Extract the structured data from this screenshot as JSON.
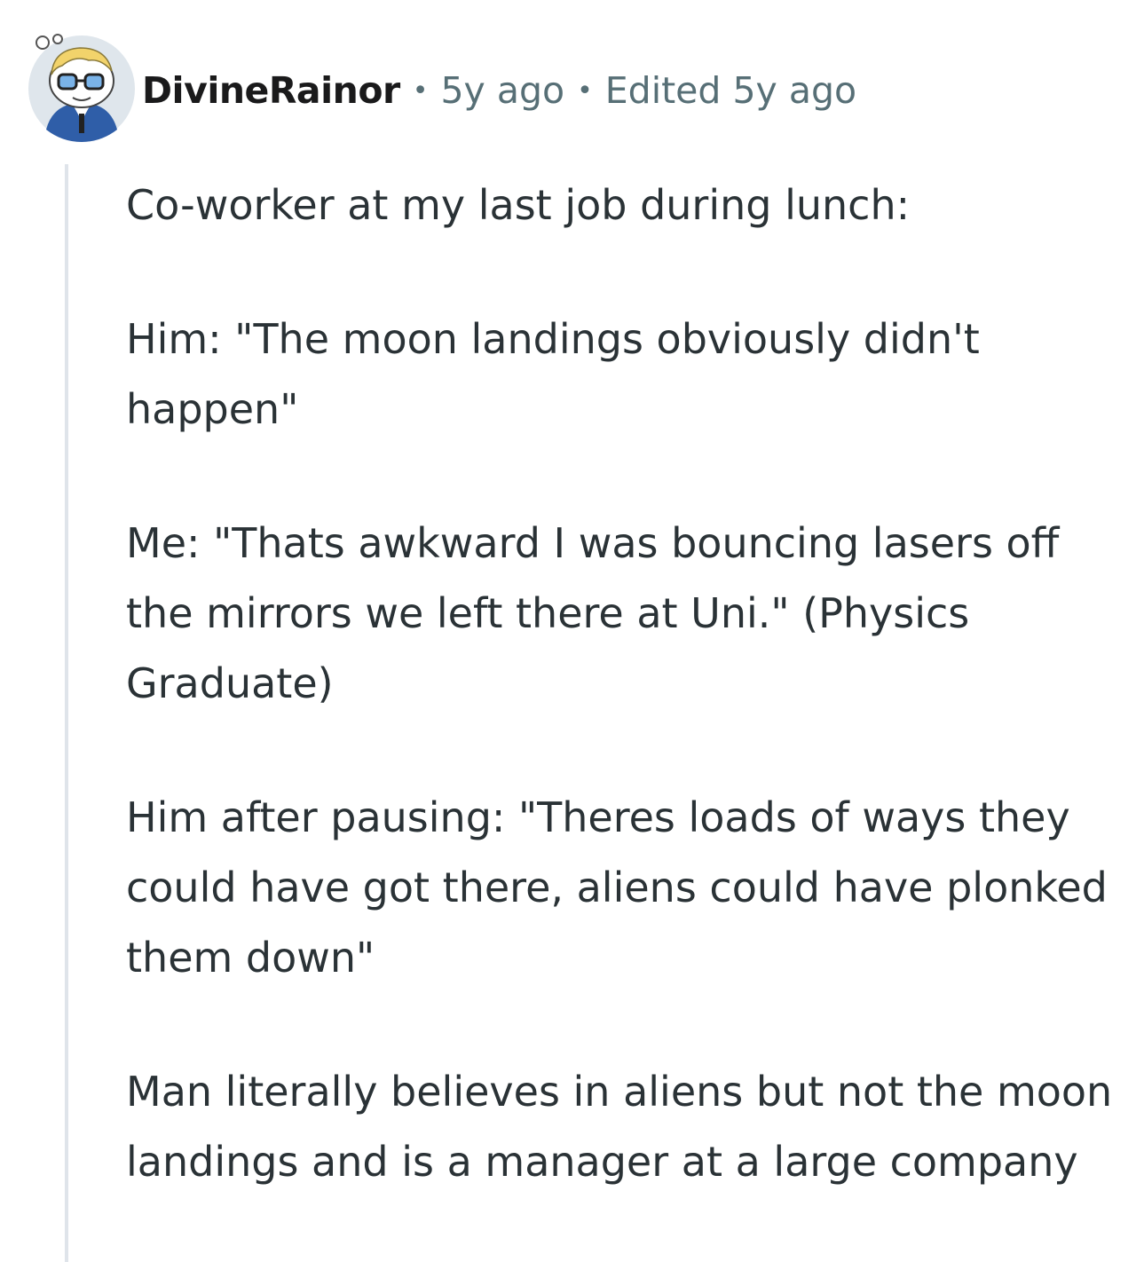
{
  "comment": {
    "author": "DivineRainor",
    "posted": "5y ago",
    "edited": "Edited 5y ago",
    "separator": "•",
    "avatar_icon": "snoo-avatar-icon",
    "paragraphs": [
      "Co-worker at my last job during lunch:",
      "Him: \"The moon landings obviously didn't happen\"",
      "Me: \"Thats awkward I was bouncing lasers off the mirrors we left there at Uni.\" (Physics Graduate)",
      "Him after pausing: \"Theres loads of ways they could have got there, aliens could have plonked them down\"",
      "Man literally believes in aliens but not the moon landings and is a manager at a large company"
    ]
  },
  "colors": {
    "meta": "#576f76",
    "thread_line": "#dfe4ea",
    "avatar_bg": "#dfe6ec"
  }
}
